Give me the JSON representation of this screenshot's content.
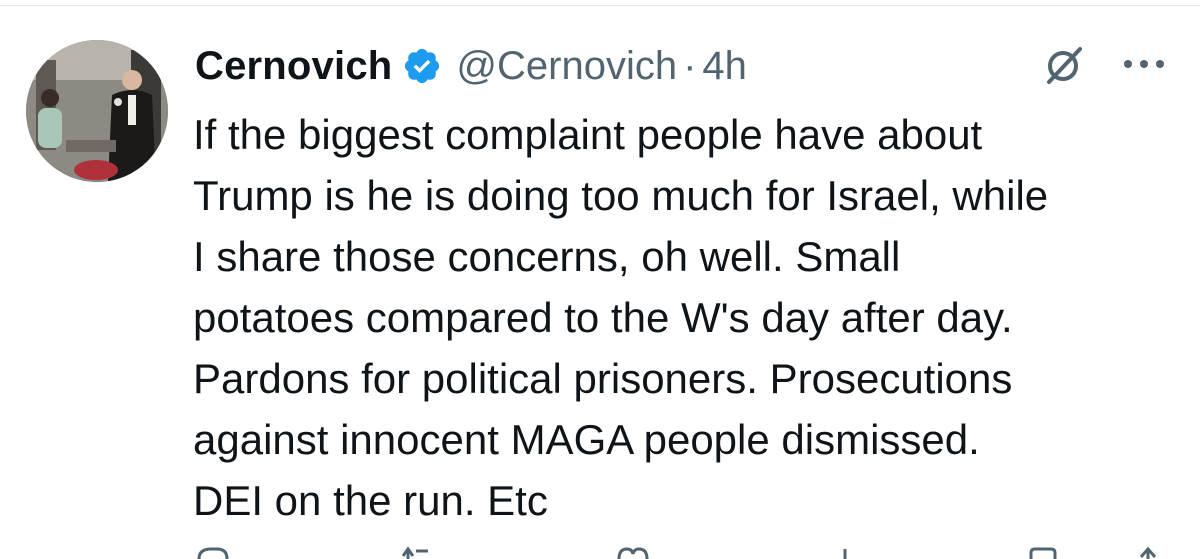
{
  "author": {
    "display_name": "Cernovich",
    "handle": "@Cernovich",
    "separator": "·",
    "timestamp": "4h",
    "verified": true
  },
  "tweet": {
    "lines": [
      "If the biggest complaint people have about",
      "Trump is he is doing too much for Israel, while",
      "I share those concerns, oh well. Small",
      "potatoes compared to the W's day after day.",
      "Pardons for political prisoners. Prosecutions",
      "against innocent MAGA people dismissed.",
      "DEI on the run. Etc"
    ]
  },
  "icons": {
    "verified": "verified-badge-icon",
    "grok": "grok-icon",
    "more": "more-options-icon",
    "reply": "reply-icon",
    "retweet": "retweet-icon",
    "like": "like-icon",
    "views": "views-icon",
    "bookmark": "bookmark-icon",
    "share": "share-icon"
  },
  "colors": {
    "text_primary": "#0f1419",
    "text_secondary": "#536471",
    "verified_blue": "#1d9bf0"
  }
}
